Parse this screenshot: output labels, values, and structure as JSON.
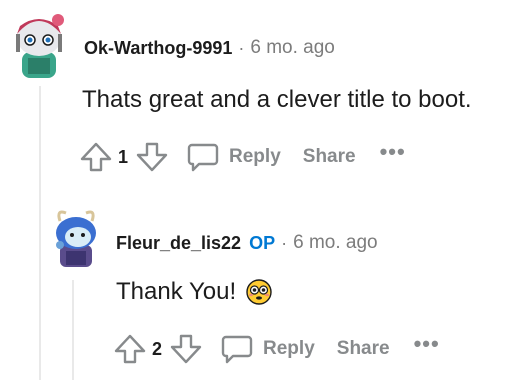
{
  "comments": [
    {
      "author": "Ok-Warthog-9991",
      "time": "6 mo. ago",
      "body": "Thats great and a clever title to boot.",
      "votes": "1",
      "reply_label": "Reply",
      "share_label": "Share",
      "more_label": "•••"
    },
    {
      "author": "Fleur_de_lis22",
      "op_label": "OP",
      "time": "6 mo. ago",
      "body": "Thank You!",
      "votes": "2",
      "reply_label": "Reply",
      "share_label": "Share",
      "more_label": "•••"
    }
  ],
  "separator": "·"
}
